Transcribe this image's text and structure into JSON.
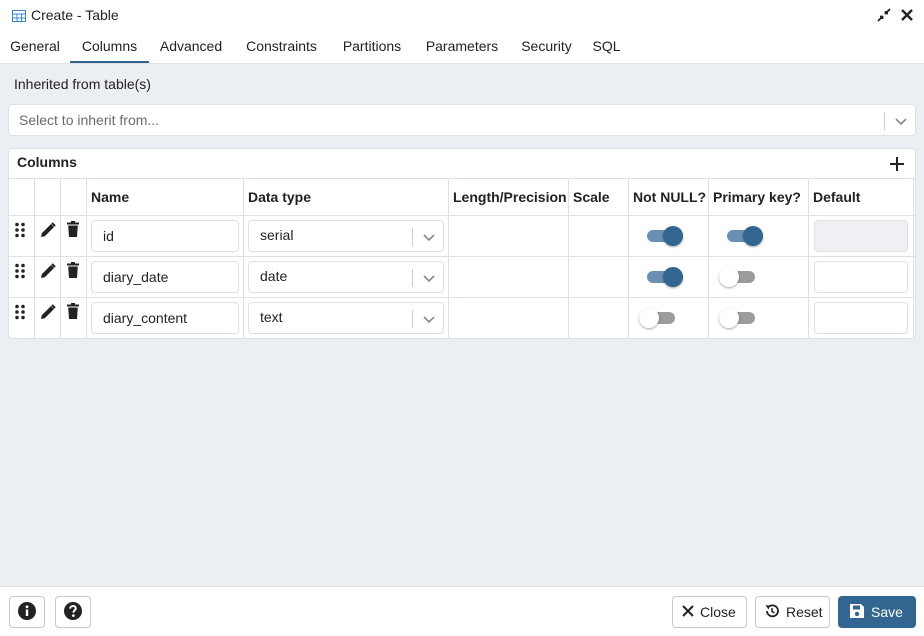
{
  "window": {
    "title": "Create - Table"
  },
  "tabs": [
    {
      "label": "General"
    },
    {
      "label": "Columns"
    },
    {
      "label": "Advanced"
    },
    {
      "label": "Constraints"
    },
    {
      "label": "Partitions"
    },
    {
      "label": "Parameters"
    },
    {
      "label": "Security"
    },
    {
      "label": "SQL"
    }
  ],
  "active_tab": "Columns",
  "inherit": {
    "label": "Inherited from table(s)",
    "placeholder": "Select to inherit from..."
  },
  "columns_panel": {
    "title": "Columns",
    "headers": {
      "name": "Name",
      "data_type": "Data type",
      "length": "Length/Precision",
      "scale": "Scale",
      "not_null": "Not NULL?",
      "primary_key": "Primary key?",
      "default": "Default"
    },
    "rows": [
      {
        "name": "id",
        "data_type": "serial",
        "not_null": true,
        "primary_key": true,
        "default_disabled": true
      },
      {
        "name": "diary_date",
        "data_type": "date",
        "not_null": true,
        "primary_key": false,
        "default_disabled": false
      },
      {
        "name": "diary_content",
        "data_type": "text",
        "not_null": false,
        "primary_key": false,
        "default_disabled": false
      }
    ]
  },
  "footer": {
    "close_label": "Close",
    "reset_label": "Reset",
    "save_label": "Save"
  },
  "colors": {
    "accent": "#326690",
    "toggle_track_on": "#6b8fb3",
    "toggle_track_off": "#9c9c9c",
    "background": "#ebeef3"
  },
  "icons": {
    "title": "table-icon",
    "minimize": "compress-icon",
    "close": "close-icon",
    "add": "plus-icon",
    "drag": "drag-handle-icon",
    "edit": "pencil-icon",
    "delete": "trash-icon",
    "info": "info-icon",
    "help": "help-icon",
    "reset": "reset-icon",
    "save": "floppy-disk-icon"
  }
}
